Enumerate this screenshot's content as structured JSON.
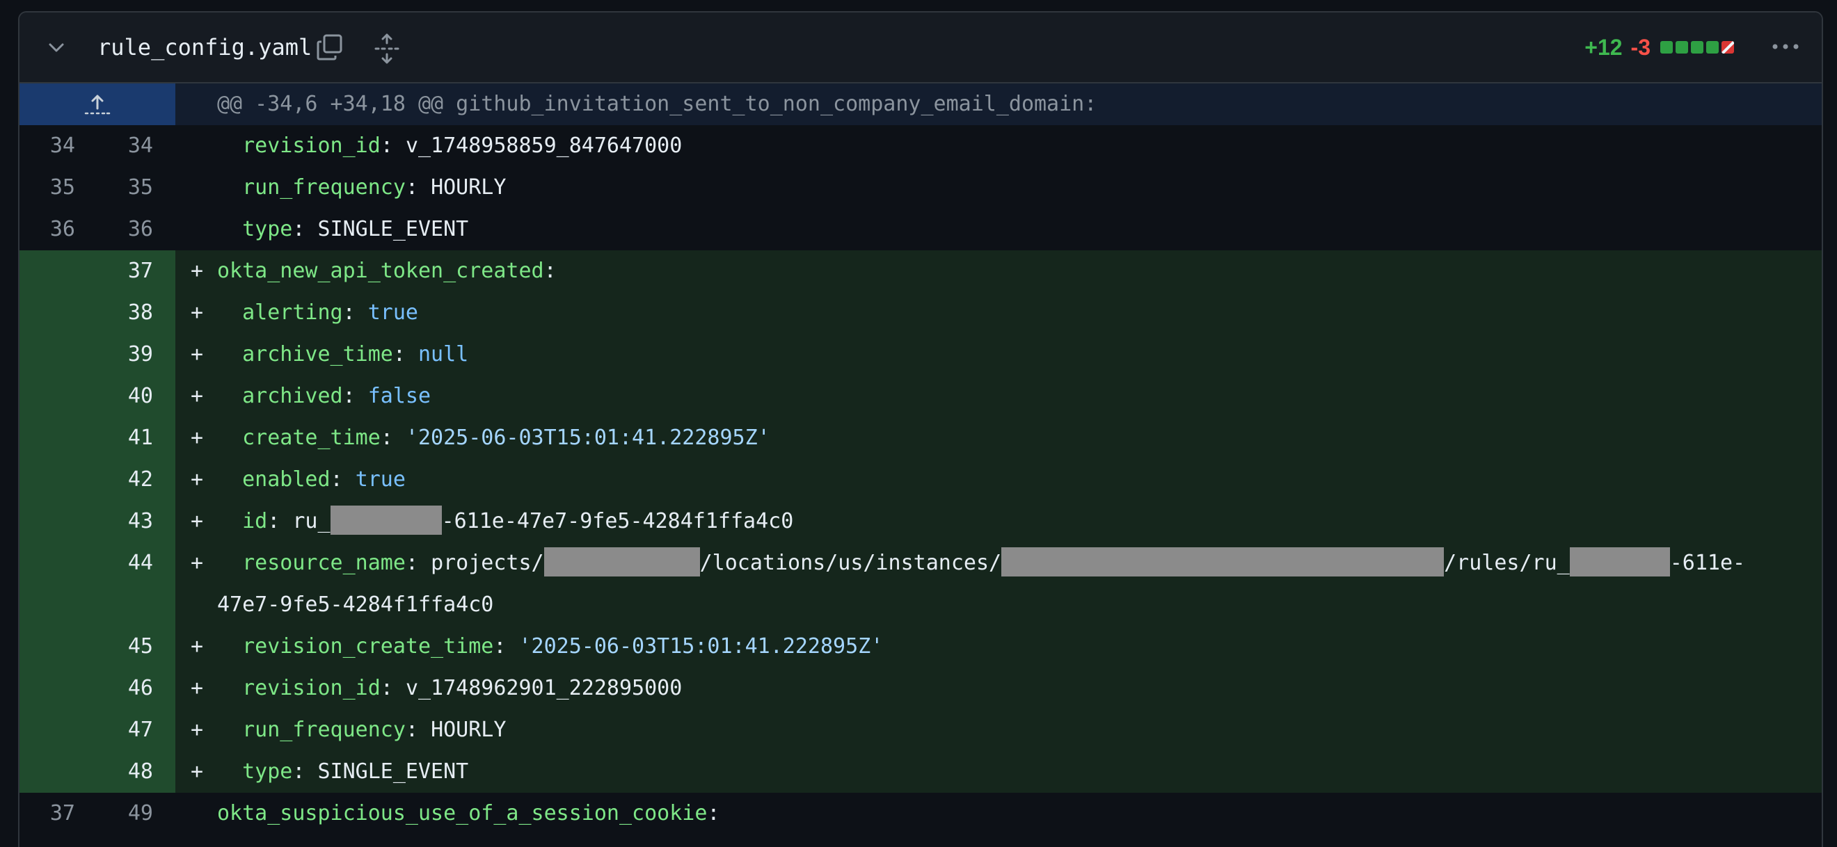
{
  "file": {
    "name": "rule_config.yaml",
    "additions": "+12",
    "deletions": "-3",
    "diffstat_blocks": [
      "added",
      "added",
      "added",
      "added",
      "deleted"
    ]
  },
  "hunk_header": "@@ -34,6 +34,18 @@ github_invitation_sent_to_non_company_email_domain:",
  "lines": [
    {
      "old": "34",
      "new": "34",
      "sign": "",
      "indent": "  ",
      "key": "revision_id",
      "value": "v_1748958859_847647000"
    },
    {
      "old": "35",
      "new": "35",
      "sign": "",
      "indent": "  ",
      "key": "run_frequency",
      "value": "HOURLY"
    },
    {
      "old": "36",
      "new": "36",
      "sign": "",
      "indent": "  ",
      "key": "type",
      "value": "SINGLE_EVENT"
    },
    {
      "old": "",
      "new": "37",
      "sign": "+",
      "indent": "",
      "key": "okta_new_api_token_created",
      "value": ""
    },
    {
      "old": "",
      "new": "38",
      "sign": "+",
      "indent": "  ",
      "key": "alerting",
      "value": "true"
    },
    {
      "old": "",
      "new": "39",
      "sign": "+",
      "indent": "  ",
      "key": "archive_time",
      "value": "null"
    },
    {
      "old": "",
      "new": "40",
      "sign": "+",
      "indent": "  ",
      "key": "archived",
      "value": "false"
    },
    {
      "old": "",
      "new": "41",
      "sign": "+",
      "indent": "  ",
      "key": "create_time",
      "value": "'2025-06-03T15:01:41.222895Z'"
    },
    {
      "old": "",
      "new": "42",
      "sign": "+",
      "indent": "  ",
      "key": "enabled",
      "value": "true"
    },
    {
      "old": "",
      "new": "43",
      "sign": "+",
      "indent": "  ",
      "key": "id",
      "value_prefix": "ru_",
      "value_suffix": "-611e-47e7-9fe5-4284f1ffa4c0"
    },
    {
      "old": "",
      "new": "44",
      "sign": "+",
      "indent": "  ",
      "key": "resource_name",
      "seg1": "projects/",
      "seg2": "/locations/us/instances/",
      "seg3": "/rules/ru_",
      "seg4": "-611e-",
      "wrap": "47e7-9fe5-4284f1ffa4c0"
    },
    {
      "old": "",
      "new": "45",
      "sign": "+",
      "indent": "  ",
      "key": "revision_create_time",
      "value": "'2025-06-03T15:01:41.222895Z'"
    },
    {
      "old": "",
      "new": "46",
      "sign": "+",
      "indent": "  ",
      "key": "revision_id",
      "value": "v_1748962901_222895000"
    },
    {
      "old": "",
      "new": "47",
      "sign": "+",
      "indent": "  ",
      "key": "run_frequency",
      "value": "HOURLY"
    },
    {
      "old": "",
      "new": "48",
      "sign": "+",
      "indent": "  ",
      "key": "type",
      "value": "SINGLE_EVENT"
    },
    {
      "old": "37",
      "new": "49",
      "sign": "",
      "indent": "",
      "key": "okta_suspicious_use_of_a_session_cookie",
      "value": ""
    }
  ],
  "colors": {
    "added_text": "#3fb950",
    "deleted_text": "#f85149",
    "yaml_key": "#7ee787",
    "yaml_value": "#a5d6ff",
    "yaml_keyword": "#79c0ff"
  },
  "icons": [
    "chevron-down-icon",
    "copy-icon",
    "expand-icon",
    "kebab-icon",
    "expand-up-icon"
  ]
}
